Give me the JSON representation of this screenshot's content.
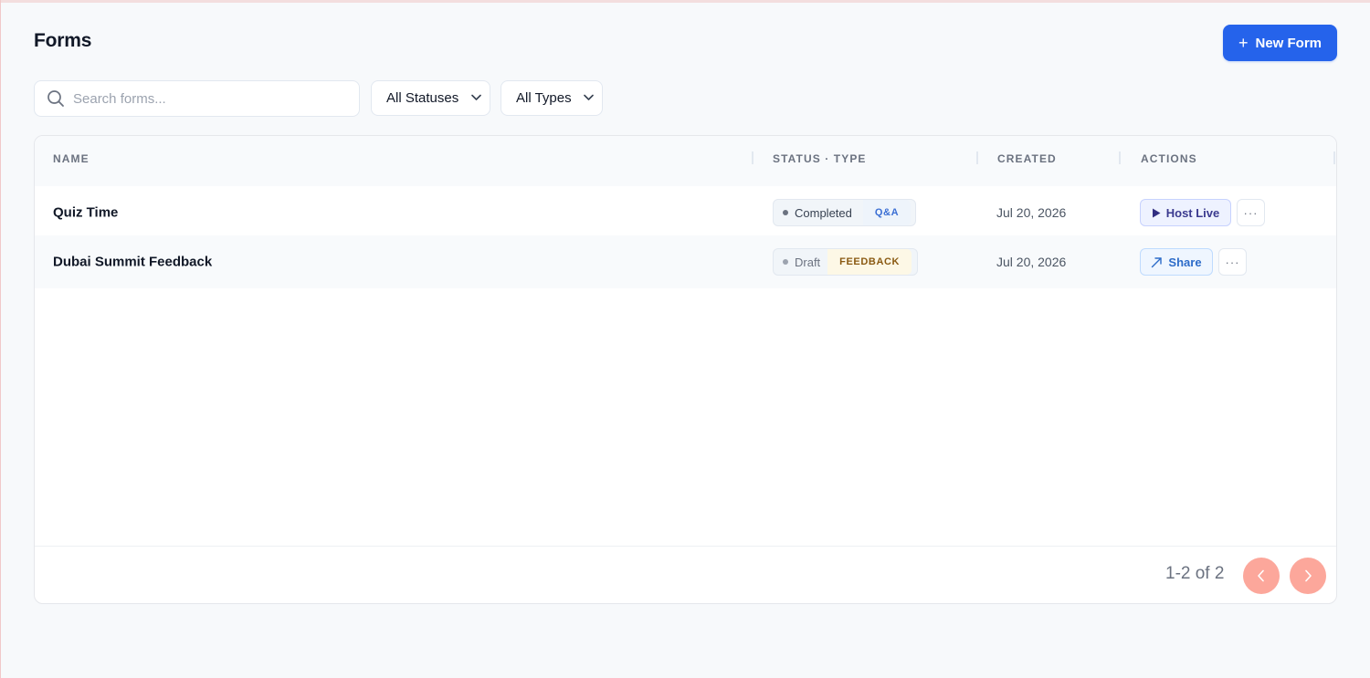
{
  "header": {
    "title": "Forms",
    "new_form_label": "New Form"
  },
  "filters": {
    "search_placeholder": "Search forms...",
    "status_value": "All Statuses",
    "type_value": "All Types"
  },
  "table": {
    "columns": [
      "NAME",
      "STATUS · TYPE",
      "CREATED",
      "ACTIONS"
    ],
    "rows": [
      {
        "name": "Quiz Time",
        "status": "Completed",
        "type": "Q&A",
        "created": "Jul 20, 2026",
        "action": "Host Live"
      },
      {
        "name": "Dubai Summit Feedback",
        "status": "Draft",
        "type": "FEEDBACK",
        "created": "Jul 20, 2026",
        "action": "Share"
      }
    ],
    "more_label": "···"
  },
  "pagination": {
    "range_text": "1-2 of 2"
  },
  "colors": {
    "accent": "#2563eb",
    "pagination_button": "#fca79b",
    "qa_tag": "#3b6fd4",
    "feedback_tag": "#8a5a12"
  }
}
